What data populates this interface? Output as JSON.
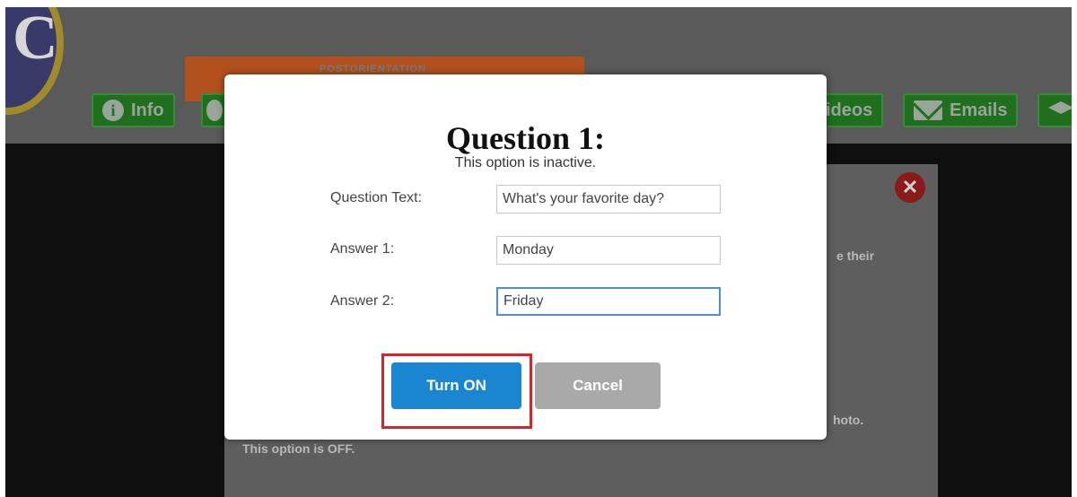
{
  "background": {
    "logo_letter": "C",
    "banner_text": "POSTORIENTATION",
    "tabs": [
      {
        "icon": "info-icon",
        "label": "Info"
      },
      {
        "icon": "video-icon",
        "label": "ideos"
      },
      {
        "icon": "mail-icon",
        "label": "Emails"
      },
      {
        "icon": "graduation-cap-icon",
        "label": ""
      }
    ],
    "text_their": "e their",
    "text_photo": "hoto.",
    "text_option_off": "This option is OFF."
  },
  "modal": {
    "title": "Question 1:",
    "subtitle": "This option is inactive.",
    "fields": [
      {
        "label": "Question Text:",
        "value": "What's your favorite day?"
      },
      {
        "label": "Answer 1:",
        "value": "Monday"
      },
      {
        "label": "Answer 2:",
        "value": "Friday"
      }
    ],
    "primary_button": "Turn ON",
    "secondary_button": "Cancel"
  },
  "colors": {
    "primary": "#1a85d0",
    "secondary": "#a9a9a9",
    "highlight": "#d2262e",
    "nav_green": "#1f6f1f"
  }
}
